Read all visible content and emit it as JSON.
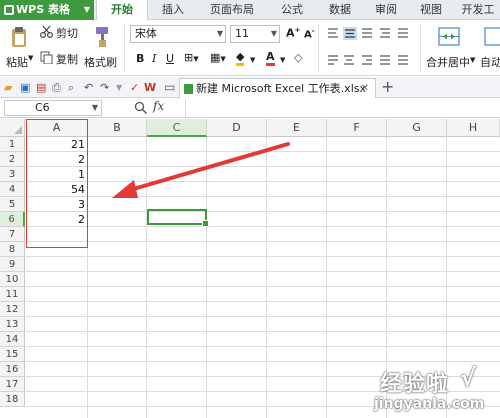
{
  "app": {
    "menu_label": "WPS 表格",
    "tabs": [
      {
        "label": "开始",
        "active": true
      },
      {
        "label": "插入",
        "active": false
      },
      {
        "label": "页面布局",
        "active": false
      },
      {
        "label": "公式",
        "active": false
      },
      {
        "label": "数据",
        "active": false
      },
      {
        "label": "审阅",
        "active": false
      },
      {
        "label": "视图",
        "active": false
      },
      {
        "label": "开发工",
        "active": false
      }
    ]
  },
  "ribbon": {
    "paste": "粘贴",
    "cut": "剪切",
    "copy": "复制",
    "format_painter": "格式刷",
    "font_name": "宋体",
    "font_size": "11",
    "merge_center": "合并居中",
    "wrap": "自动"
  },
  "document": {
    "tab_title": "新建 Microsoft Excel 工作表.xlsx"
  },
  "formula_bar": {
    "name_box": "C6",
    "fx": "fx",
    "formula": ""
  },
  "sheet": {
    "columns": [
      "A",
      "B",
      "C",
      "D",
      "E",
      "F",
      "G",
      "H"
    ],
    "selected_column": "C",
    "rows": [
      "1",
      "2",
      "3",
      "4",
      "5",
      "6",
      "7",
      "8",
      "9",
      "10",
      "11",
      "12",
      "13",
      "14",
      "15",
      "16",
      "17",
      "18"
    ],
    "selected_row": "6",
    "active_cell": "C6",
    "column_a_values": [
      "21",
      "2",
      "1",
      "54",
      "3",
      "2"
    ]
  },
  "colors": {
    "accent_green": "#3f9a3f",
    "annotation_red": "#e53935"
  },
  "watermark": {
    "line1": "经验啦",
    "check": "√",
    "line2": "jingyanla.com"
  }
}
